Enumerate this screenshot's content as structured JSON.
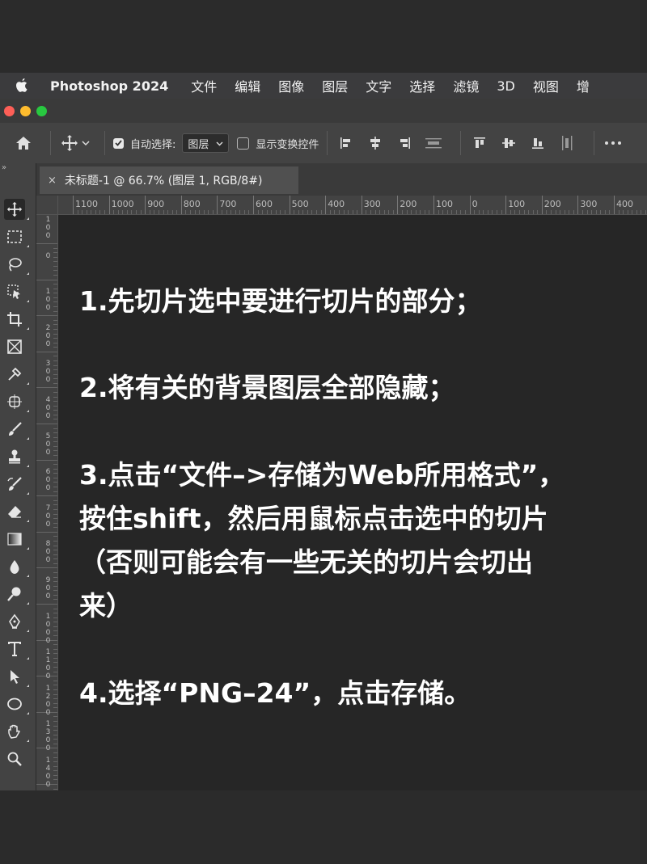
{
  "menubar": {
    "app_name": "Photoshop 2024",
    "items": [
      "文件",
      "编辑",
      "图像",
      "图层",
      "文字",
      "选择",
      "滤镜",
      "3D",
      "视图",
      "增"
    ]
  },
  "window": {
    "traffic_lights": {
      "close": "#fe5f57",
      "minimize": "#febc2e",
      "zoom": "#28c840"
    }
  },
  "options_bar": {
    "auto_select_label": "自动选择:",
    "auto_select_checked": true,
    "auto_select_target": "图层",
    "show_transform_label": "显示变换控件",
    "show_transform_checked": false
  },
  "document_tab": {
    "close_glyph": "×",
    "title": "未标题-1 @ 66.7% (图层 1, RGB/8#)"
  },
  "rulers": {
    "horizontal": [
      "1100",
      "1000",
      "900",
      "800",
      "700",
      "600",
      "500",
      "400",
      "300",
      "200",
      "100",
      "0",
      "100",
      "200",
      "300",
      "400"
    ],
    "vertical": [
      "100",
      "0",
      "100",
      "200",
      "300",
      "400",
      "500",
      "600",
      "700",
      "800",
      "900",
      "1000",
      "1100",
      "1200",
      "1300",
      "1400"
    ]
  },
  "tools": [
    "move-tool",
    "marquee-tool",
    "lasso-tool",
    "object-select-tool",
    "crop-tool",
    "frame-tool",
    "eyedropper-tool",
    "spot-heal-tool",
    "brush-tool",
    "stamp-tool",
    "history-brush-tool",
    "eraser-tool",
    "gradient-tool",
    "blur-tool",
    "dodge-tool",
    "pen-tool",
    "type-tool",
    "path-select-tool",
    "ellipse-tool",
    "hand-tool",
    "zoom-tool"
  ],
  "canvas_text": {
    "line1": "1.先切片选中要进行切片的部分；",
    "line2": "2.将有关的背景图层全部隐藏；",
    "line3a": "3.点击“文件–>存储为Web所用格式”，",
    "line3b": "按住shift，然后用鼠标点击选中的切片",
    "line3c": "（否则可能会有一些无关的切片会切出",
    "line3d": "来）",
    "line4": "4.选择“PNG–24”，点击存储。"
  }
}
